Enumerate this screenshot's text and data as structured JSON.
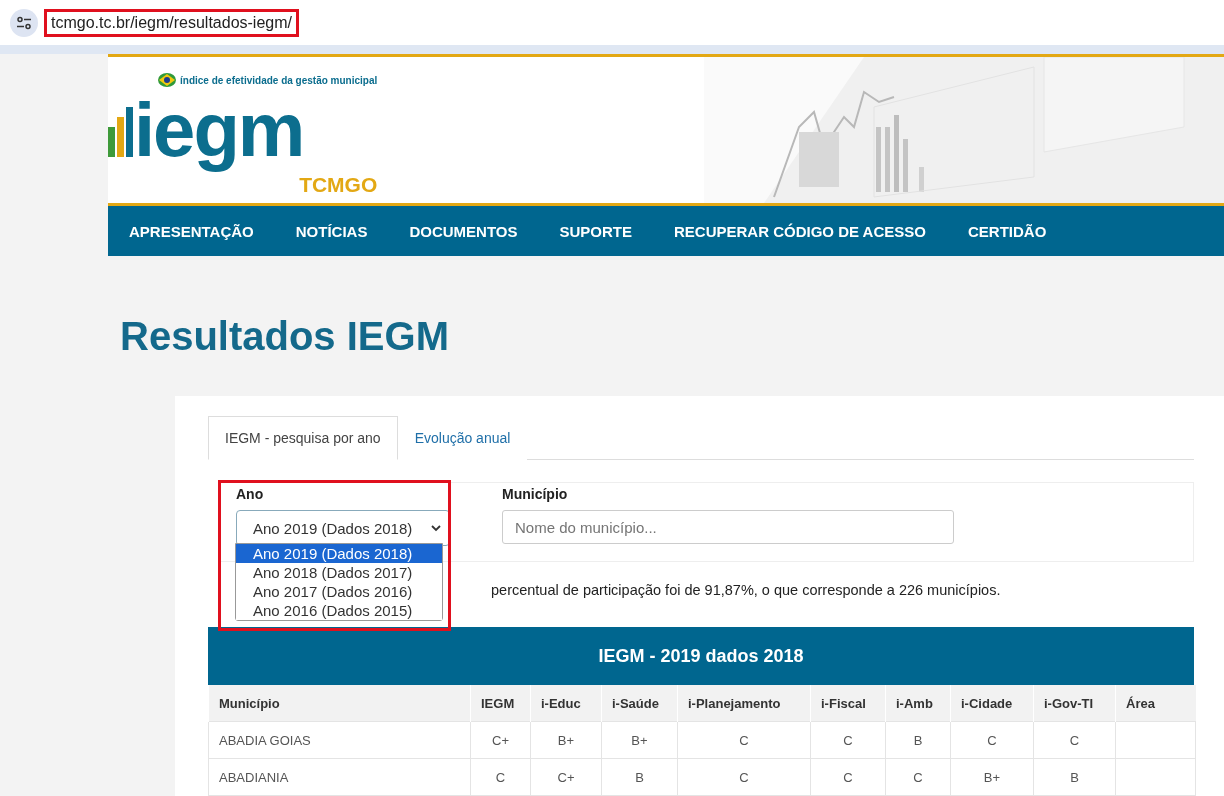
{
  "browser": {
    "url": "tcmgo.tc.br/iegm/resultados-iegm/"
  },
  "logo": {
    "tagline": "índice de efetividade da gestão municipal",
    "wordmark": "iegm",
    "sub": "TCMGO"
  },
  "nav": [
    "APRESENTAÇÃO",
    "NOTÍCIAS",
    "DOCUMENTOS",
    "SUPORTE",
    "RECUPERAR CÓDIGO DE ACESSO",
    "CERTIDÃO"
  ],
  "page_title": "Resultados IEGM",
  "tabs": [
    {
      "label": "IEGM - pesquisa por ano",
      "selected": true
    },
    {
      "label": "Evolução anual",
      "selected": false
    }
  ],
  "filters": {
    "year_label": "Ano",
    "year_value": "Ano 2019 (Dados 2018)",
    "municipality_label": "Município",
    "municipality_placeholder": "Nome do município..."
  },
  "year_options": [
    {
      "label": "Ano 2019 (Dados 2018)",
      "selected": true
    },
    {
      "label": "Ano 2018 (Dados 2017)",
      "selected": false
    },
    {
      "label": "Ano 2017 (Dados 2016)",
      "selected": false
    },
    {
      "label": "Ano 2016 (Dados 2015)",
      "selected": false
    }
  ],
  "note": "percentual de participação foi de 91,87%, o que corresponde a 226 municípios.",
  "table": {
    "title": "IEGM - 2019 dados 2018",
    "columns": [
      "Município",
      "IEGM",
      "i-Educ",
      "i-Saúde",
      "i-Planejamento",
      "i-Fiscal",
      "i-Amb",
      "i-Cidade",
      "i-Gov-TI",
      "Área"
    ],
    "rows": [
      [
        "ABADIA GOIAS",
        "C+",
        "B+",
        "B+",
        "C",
        "C",
        "B",
        "C",
        "C"
      ],
      [
        "ABADIANIA",
        "C",
        "C+",
        "B",
        "C",
        "C",
        "C",
        "B+",
        "B"
      ]
    ]
  }
}
